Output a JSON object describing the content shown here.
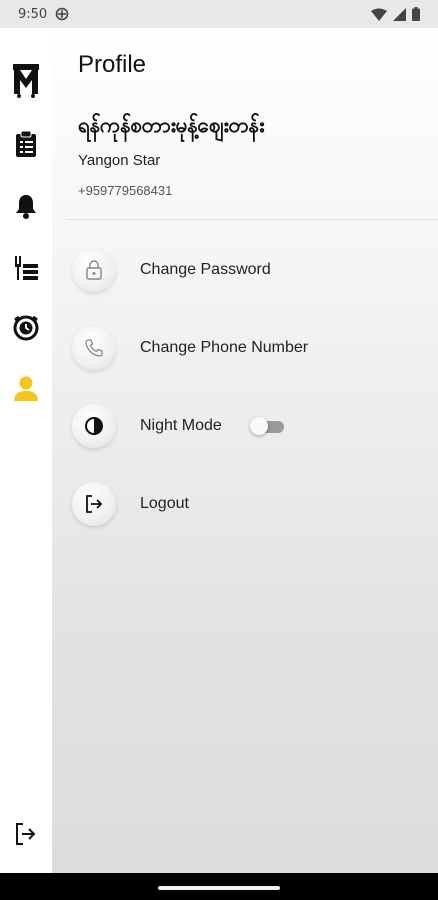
{
  "status_bar": {
    "time": "9:50",
    "icons": [
      "data-saver-icon",
      "wifi-icon",
      "signal-icon",
      "battery-icon"
    ]
  },
  "rail": {
    "items": [
      {
        "name": "shop-logo-icon"
      },
      {
        "name": "orders-clipboard-icon"
      },
      {
        "name": "bell-icon"
      },
      {
        "name": "menu-food-icon"
      },
      {
        "name": "history-clock-icon"
      },
      {
        "name": "profile-user-icon",
        "active": true,
        "color": "#f5c518"
      }
    ],
    "bottom_item": {
      "name": "exit-icon"
    }
  },
  "profile": {
    "title": "Profile",
    "shop_name": "ရန်ကုန်စတားမုန့်ဈေးတန်း",
    "sub_name": "Yangon Star",
    "phone": "+959779568431"
  },
  "menu": {
    "change_password": {
      "label": "Change Password",
      "icon": "lock-icon"
    },
    "change_phone": {
      "label": "Change Phone Number",
      "icon": "phone-icon"
    },
    "night_mode": {
      "label": "Night Mode",
      "icon": "contrast-icon",
      "enabled": false
    },
    "logout": {
      "label": "Logout",
      "icon": "logout-icon"
    }
  },
  "colors": {
    "accent": "#f5c518",
    "text": "#222222",
    "rail_bg": "#ffffff"
  }
}
